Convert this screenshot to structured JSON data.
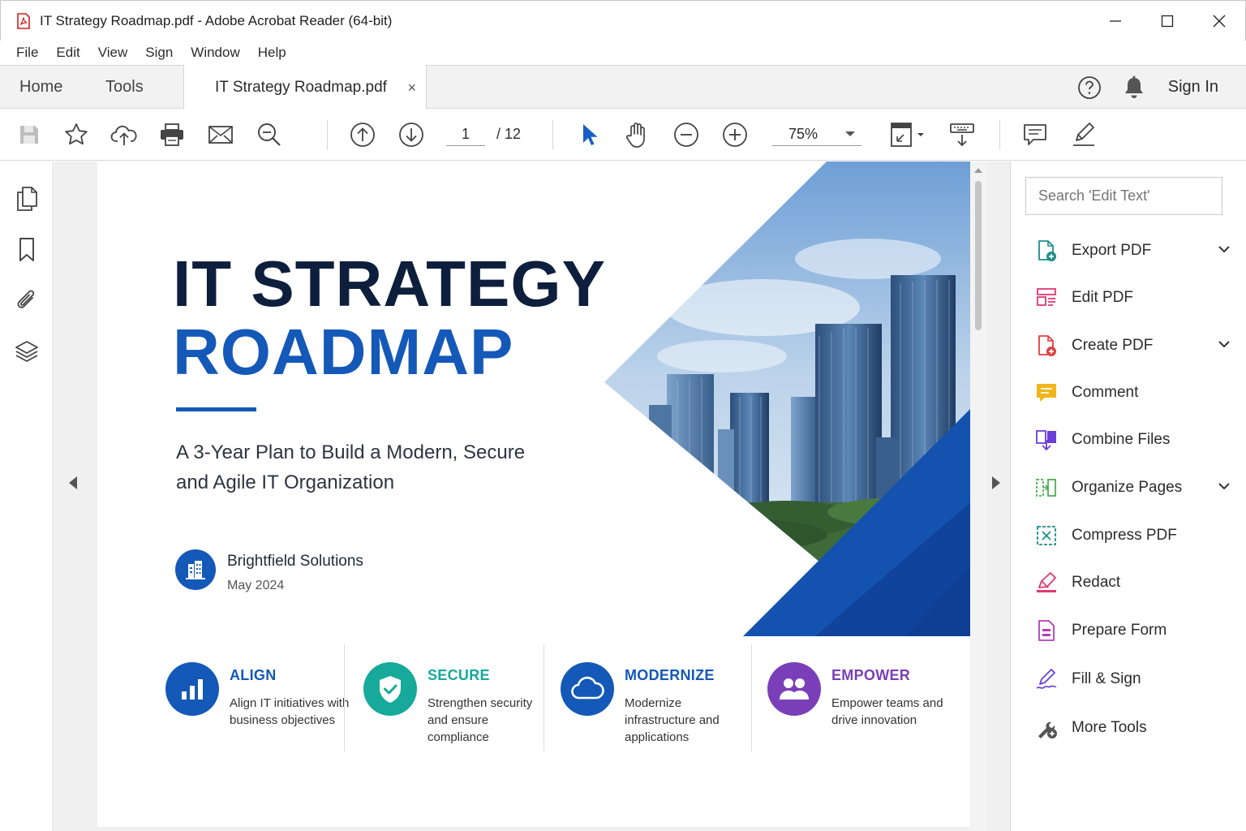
{
  "window": {
    "title": "IT Strategy Roadmap.pdf - Adobe Acrobat Reader (64-bit)",
    "controls": [
      "minimize-icon",
      "maximize-icon",
      "close-icon"
    ]
  },
  "menu": [
    "File",
    "Edit",
    "View",
    "Sign",
    "Window",
    "Help"
  ],
  "tabs": {
    "home": "Home",
    "tools": "Tools",
    "document": "IT Strategy Roadmap.pdf",
    "close": "×",
    "sign_in": "Sign In"
  },
  "toolbar": {
    "page_current": "1",
    "page_total": "/  12",
    "zoom": "75%"
  },
  "document": {
    "title_line1": "IT STRATEGY",
    "title_line2": "ROADMAP",
    "subtitle": "A 3-Year Plan to Build a Modern, Secure and Agile IT Organization",
    "company": "Brightfield Solutions",
    "date": "May 2024",
    "pillars": [
      {
        "heading": "ALIGN",
        "text": "Align IT initiatives with business objectives",
        "color": "#1458b8"
      },
      {
        "heading": "SECURE",
        "text": "Strengthen security and ensure compliance",
        "color": "#17a99a"
      },
      {
        "heading": "MODERNIZE",
        "text": "Modernize infrastructure and applications",
        "color": "#1458b8"
      },
      {
        "heading": "EMPOWER",
        "text": "Empower teams and drive innovation",
        "color": "#7a3fb8"
      }
    ]
  },
  "right_panel": {
    "search_placeholder": "Search 'Edit Text'",
    "tools": [
      {
        "label": "Export PDF",
        "icon": "export-pdf-icon",
        "expandable": true
      },
      {
        "label": "Edit PDF",
        "icon": "edit-pdf-icon",
        "expandable": false
      },
      {
        "label": "Create PDF",
        "icon": "create-pdf-icon",
        "expandable": true
      },
      {
        "label": "Comment",
        "icon": "comment-icon",
        "expandable": false
      },
      {
        "label": "Combine Files",
        "icon": "combine-files-icon",
        "expandable": false
      },
      {
        "label": "Organize Pages",
        "icon": "organize-pages-icon",
        "expandable": true
      },
      {
        "label": "Compress PDF",
        "icon": "compress-pdf-icon",
        "expandable": false
      },
      {
        "label": "Redact",
        "icon": "redact-icon",
        "expandable": false
      },
      {
        "label": "Prepare Form",
        "icon": "prepare-form-icon",
        "expandable": false
      },
      {
        "label": "Fill & Sign",
        "icon": "fill-sign-icon",
        "expandable": false
      },
      {
        "label": "More Tools",
        "icon": "more-tools-icon",
        "expandable": false
      }
    ]
  }
}
